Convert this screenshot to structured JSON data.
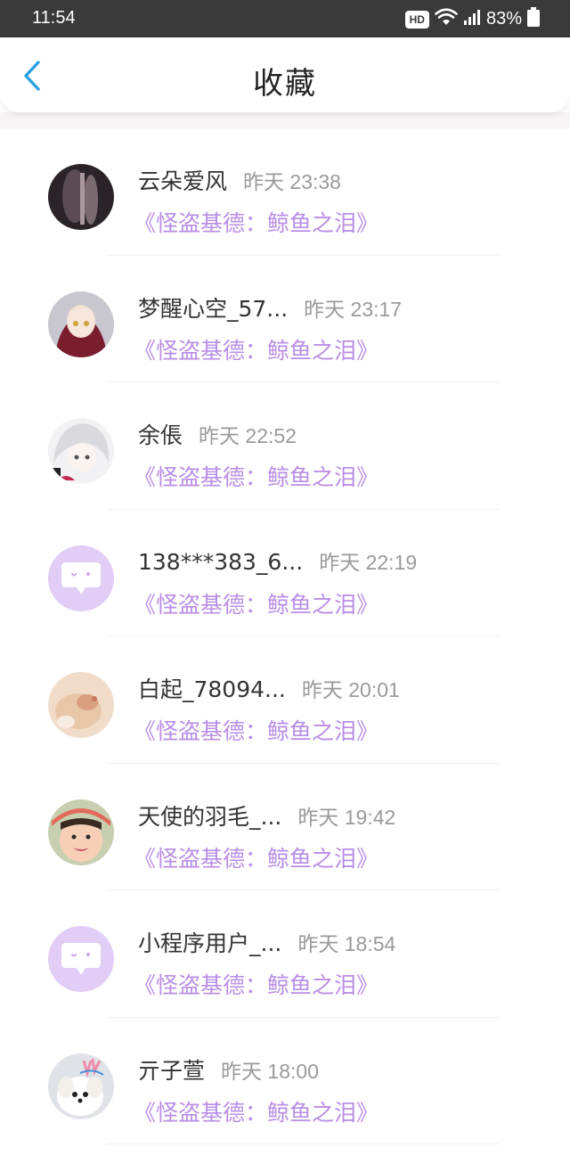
{
  "status_bar": {
    "time": "11:54",
    "network_badge": "HD",
    "battery": "83%"
  },
  "header": {
    "title": "收藏"
  },
  "colors": {
    "accent_link": "#b98ee6",
    "back_arrow": "#2aa0e6",
    "default_avatar_bg": "#e2cdf6"
  },
  "items": [
    {
      "name": "云朵爱风",
      "time": "昨天 23:38",
      "title": "《怪盗基德：鲸鱼之泪》",
      "avatar": "photo"
    },
    {
      "name": "梦醒心空_57...",
      "time": "昨天 23:17",
      "title": "《怪盗基德：鲸鱼之泪》",
      "avatar": "photo"
    },
    {
      "name": "余倀",
      "time": "昨天 22:52",
      "title": "《怪盗基德：鲸鱼之泪》",
      "avatar": "photo"
    },
    {
      "name": "138***383_6...",
      "time": "昨天 22:19",
      "title": "《怪盗基德：鲸鱼之泪》",
      "avatar": "default-chat-bubble"
    },
    {
      "name": "白起_78094...",
      "time": "昨天 20:01",
      "title": "《怪盗基德：鲸鱼之泪》",
      "avatar": "photo"
    },
    {
      "name": "天使的羽毛_...",
      "time": "昨天 19:42",
      "title": "《怪盗基德：鲸鱼之泪》",
      "avatar": "photo"
    },
    {
      "name": "小程序用户_...",
      "time": "昨天 18:54",
      "title": "《怪盗基德：鲸鱼之泪》",
      "avatar": "default-chat-bubble"
    },
    {
      "name": "亓子萱",
      "time": "昨天 18:00",
      "title": "《怪盗基德：鲸鱼之泪》",
      "avatar": "photo"
    }
  ]
}
